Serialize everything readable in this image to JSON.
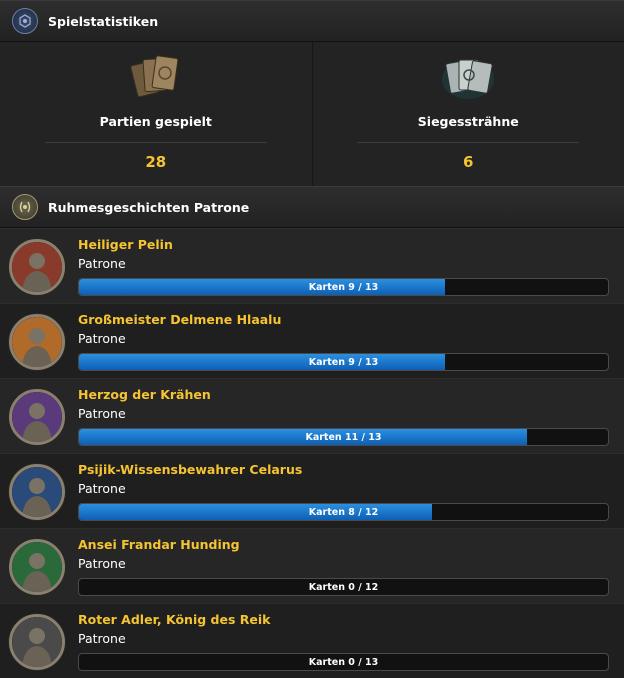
{
  "stats_header": {
    "title": "Spielstatistiken",
    "icon": "emblem-icon"
  },
  "stats": [
    {
      "label": "Partien gespielt",
      "value": "28",
      "icon": "card-backs-icon"
    },
    {
      "label": "Siegessträhne",
      "value": "6",
      "icon": "glowing-cards-icon"
    }
  ],
  "patrons_header": {
    "title": "Ruhmesgeschichten Patrone",
    "icon": "laurel-icon"
  },
  "patrons": [
    {
      "name": "Heiliger Pelin",
      "subtitle": "Patrone",
      "progress_label": "Karten 9 / 13",
      "progress": 0.692,
      "ring_color": "#8a3a2a"
    },
    {
      "name": "Großmeister Delmene Hlaalu",
      "subtitle": "Patrone",
      "progress_label": "Karten 9 / 13",
      "progress": 0.692,
      "ring_color": "#b06a2a"
    },
    {
      "name": "Herzog der Krähen",
      "subtitle": "Patrone",
      "progress_label": "Karten 11 / 13",
      "progress": 0.846,
      "ring_color": "#5a3a7a"
    },
    {
      "name": "Psijik-Wissensbewahrer Celarus",
      "subtitle": "Patrone",
      "progress_label": "Karten 8 / 12",
      "progress": 0.667,
      "ring_color": "#2a4a7a"
    },
    {
      "name": "Ansei Frandar Hunding",
      "subtitle": "Patrone",
      "progress_label": "Karten 0 / 12",
      "progress": 0,
      "ring_color": "#2a6a3a"
    },
    {
      "name": "Roter Adler, König des Reik",
      "subtitle": "Patrone",
      "progress_label": "Karten 0 / 13",
      "progress": 0,
      "ring_color": "#4a4a4a"
    }
  ]
}
